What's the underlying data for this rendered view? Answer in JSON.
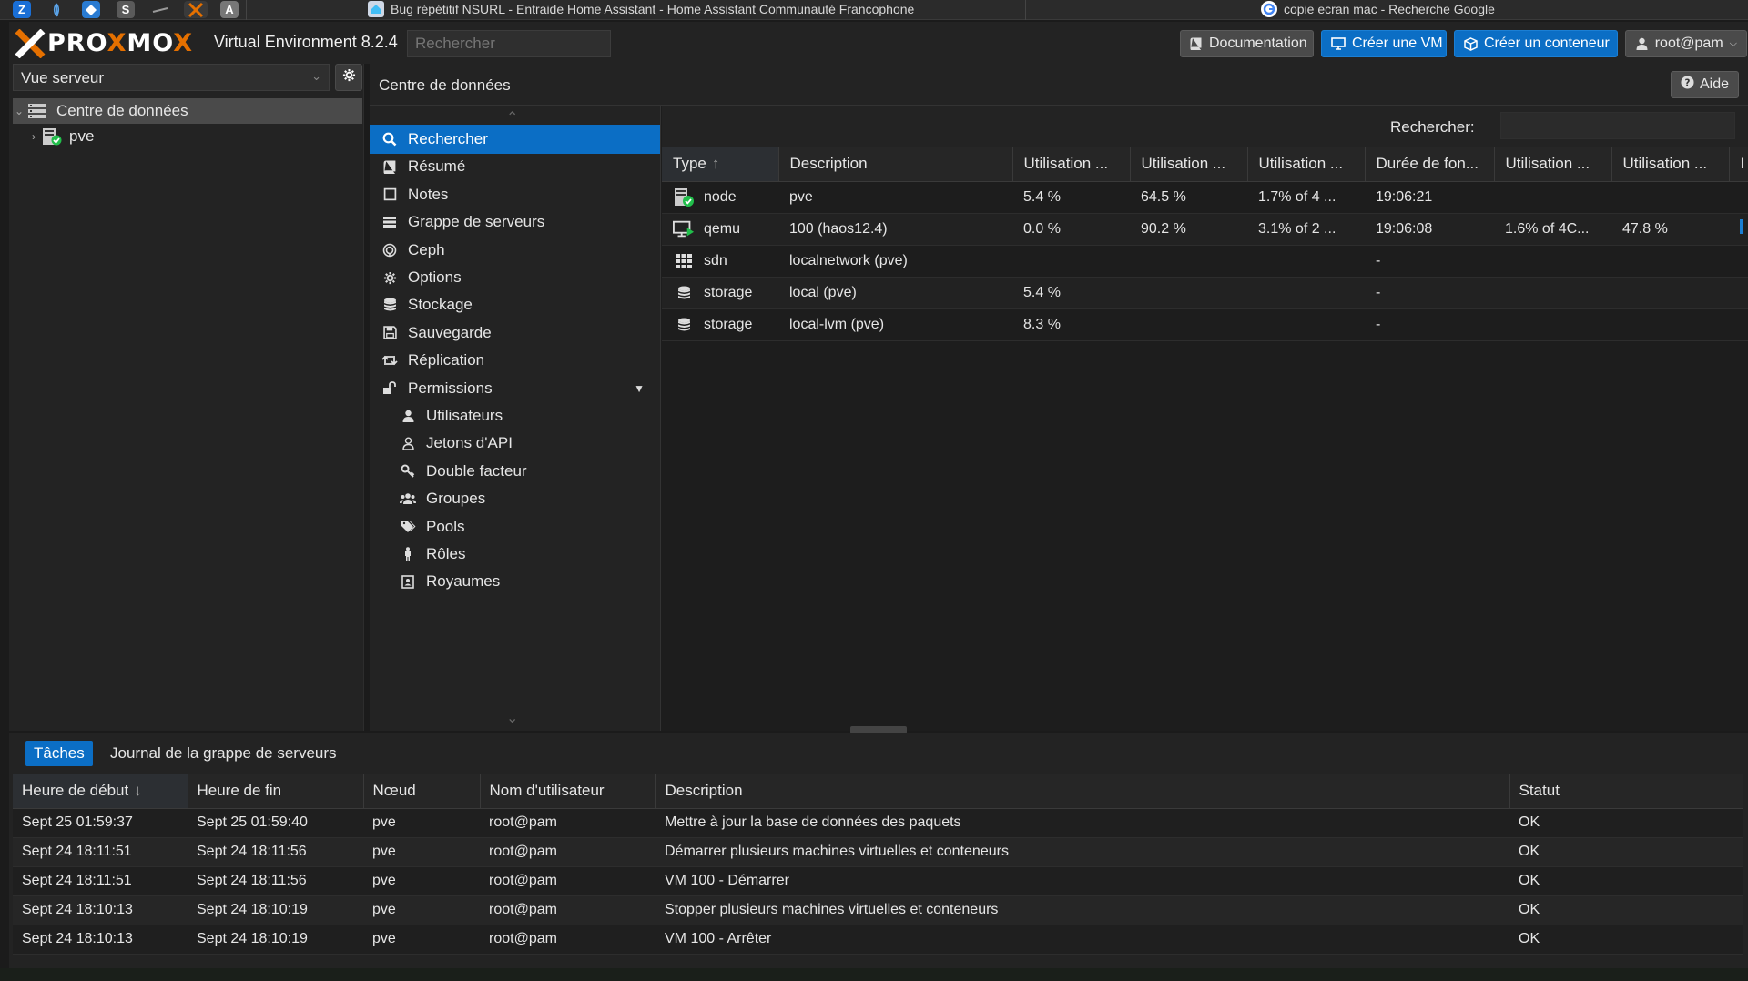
{
  "browser": {
    "tabs": [
      {
        "title": "Bug répétitif NSURL - Entraide Home Assistant - Home Assistant Communauté Francophone"
      },
      {
        "title": "copie ecran mac - Recherche Google"
      }
    ],
    "app_icons": [
      "Z",
      "S",
      "A"
    ]
  },
  "header": {
    "brand_left": "PRO",
    "brand_x1": "X",
    "brand_mid": "MO",
    "brand_x2": "X",
    "version": "Virtual Environment 8.2.4",
    "search_placeholder": "Rechercher",
    "documentation": "Documentation",
    "create_vm": "Créer une VM",
    "create_ct": "Créer un conteneur",
    "user": "root@pam"
  },
  "tree": {
    "view": "Vue serveur",
    "datacenter": "Centre de données",
    "node": "pve"
  },
  "content": {
    "title": "Centre de données",
    "help": "Aide",
    "search_label": "Rechercher:"
  },
  "menu": [
    {
      "label": "Rechercher",
      "icon": "search-icon"
    },
    {
      "label": "Résumé",
      "icon": "book-icon"
    },
    {
      "label": "Notes",
      "icon": "notes-icon"
    },
    {
      "label": "Grappe de serveurs",
      "icon": "server-icon"
    },
    {
      "label": "Ceph",
      "icon": "ceph-icon"
    },
    {
      "label": "Options",
      "icon": "gear-icon"
    },
    {
      "label": "Stockage",
      "icon": "database-icon"
    },
    {
      "label": "Sauvegarde",
      "icon": "floppy-icon"
    },
    {
      "label": "Réplication",
      "icon": "retweet-icon"
    },
    {
      "label": "Permissions",
      "icon": "unlock-icon"
    },
    {
      "label": "Utilisateurs",
      "icon": "user-icon"
    },
    {
      "label": "Jetons d'API",
      "icon": "user-outline-icon"
    },
    {
      "label": "Double facteur",
      "icon": "key-icon"
    },
    {
      "label": "Groupes",
      "icon": "users-icon"
    },
    {
      "label": "Pools",
      "icon": "tags-icon"
    },
    {
      "label": "Rôles",
      "icon": "male-icon"
    },
    {
      "label": "Royaumes",
      "icon": "address-book-icon"
    }
  ],
  "resources": {
    "columns": [
      "Type",
      "Description",
      "Utilisation ...",
      "Utilisation ...",
      "Utilisation ...",
      "Durée de fon...",
      "Utilisation ...",
      "Utilisation ...",
      "I"
    ],
    "rows": [
      {
        "type": "node",
        "icon": "node-icon",
        "desc": "pve",
        "c1": "5.4 %",
        "c2": "64.5 %",
        "c3": "1.7% of 4 ...",
        "uptime": "19:06:21",
        "c5": "",
        "c6": ""
      },
      {
        "type": "qemu",
        "icon": "vm-running-icon",
        "desc": "100 (haos12.4)",
        "c1": "0.0 %",
        "c2": "90.2 %",
        "c3": "3.1% of 2 ...",
        "uptime": "19:06:08",
        "c5": "1.6% of 4C...",
        "c6": "47.8 %"
      },
      {
        "type": "sdn",
        "icon": "grid-icon",
        "desc": "localnetwork (pve)",
        "c1": "",
        "c2": "",
        "c3": "",
        "uptime": "-",
        "c5": "",
        "c6": ""
      },
      {
        "type": "storage",
        "icon": "database-icon",
        "desc": "local (pve)",
        "c1": "5.4 %",
        "c2": "",
        "c3": "",
        "uptime": "-",
        "c5": "",
        "c6": ""
      },
      {
        "type": "storage",
        "icon": "database-icon",
        "desc": "local-lvm (pve)",
        "c1": "8.3 %",
        "c2": "",
        "c3": "",
        "uptime": "-",
        "c5": "",
        "c6": ""
      }
    ]
  },
  "tasks": {
    "tab_tasks": "Tâches",
    "tab_log": "Journal de la grappe de serveurs",
    "columns": [
      "Heure de début",
      "Heure de fin",
      "Nœud",
      "Nom d'utilisateur",
      "Description",
      "Statut"
    ],
    "rows": [
      {
        "start": "Sept 25 01:59:37",
        "end": "Sept 25 01:59:40",
        "node": "pve",
        "user": "root@pam",
        "desc": "Mettre à jour la base de données des paquets",
        "status": "OK"
      },
      {
        "start": "Sept 24 18:11:51",
        "end": "Sept 24 18:11:56",
        "node": "pve",
        "user": "root@pam",
        "desc": "Démarrer plusieurs machines virtuelles et conteneurs",
        "status": "OK"
      },
      {
        "start": "Sept 24 18:11:51",
        "end": "Sept 24 18:11:56",
        "node": "pve",
        "user": "root@pam",
        "desc": "VM 100 - Démarrer",
        "status": "OK"
      },
      {
        "start": "Sept 24 18:10:13",
        "end": "Sept 24 18:10:19",
        "node": "pve",
        "user": "root@pam",
        "desc": "Stopper plusieurs machines virtuelles et conteneurs",
        "status": "OK"
      },
      {
        "start": "Sept 24 18:10:13",
        "end": "Sept 24 18:10:19",
        "node": "pve",
        "user": "root@pam",
        "desc": "VM 100 - Arrêter",
        "status": "OK"
      }
    ]
  },
  "colors": {
    "accent": "#0b6ec5",
    "brand_orange": "#e57000",
    "ok_green": "#21bf4b"
  }
}
